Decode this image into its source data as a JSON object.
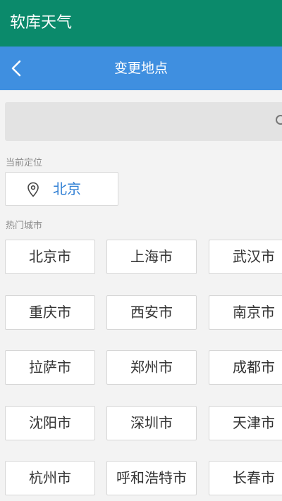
{
  "app": {
    "title": "软库天气"
  },
  "nav": {
    "title": "变更地点",
    "back_icon": "chevron-left-icon"
  },
  "search": {
    "placeholder": "",
    "icon": "search-icon"
  },
  "current_location": {
    "label": "当前定位",
    "city": "北京",
    "icon": "map-pin-icon"
  },
  "hot_cities": {
    "label": "热门城市",
    "items": [
      "北京市",
      "上海市",
      "武汉市",
      "重庆市",
      "西安市",
      "南京市",
      "拉萨市",
      "郑州市",
      "成都市",
      "沈阳市",
      "深圳市",
      "天津市",
      "杭州市",
      "呼和浩特市",
      "长春市"
    ]
  },
  "colors": {
    "app_bar": "#0b8a6b",
    "nav_bar": "#3f8fe0",
    "location_text": "#2f7fd4",
    "background": "#f3f3f3"
  }
}
